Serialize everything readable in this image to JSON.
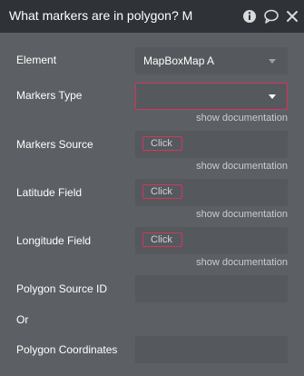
{
  "header": {
    "title": "What markers are in polygon? M",
    "icons": [
      "info-icon",
      "comment-icon",
      "close-icon"
    ]
  },
  "fields": {
    "element": {
      "label": "Element",
      "value": "MapBoxMap A"
    },
    "markers_type": {
      "label": "Markers Type",
      "value": "",
      "doc": "show documentation"
    },
    "markers_source": {
      "label": "Markers Source",
      "button": "Click",
      "doc": "show documentation"
    },
    "latitude_field": {
      "label": "Latitude Field",
      "button": "Click",
      "doc": "show documentation"
    },
    "longitude_field": {
      "label": "Longitude Field",
      "button": "Click",
      "doc": "show documentation"
    },
    "polygon_source_id": {
      "label": "Polygon Source ID",
      "value": ""
    },
    "or_text": "Or",
    "polygon_coordinates": {
      "label": "Polygon Coordinates",
      "value": ""
    }
  },
  "colors": {
    "header_bg": "#2f3337",
    "panel_bg": "#5c6064",
    "accent": "#d4345b"
  }
}
